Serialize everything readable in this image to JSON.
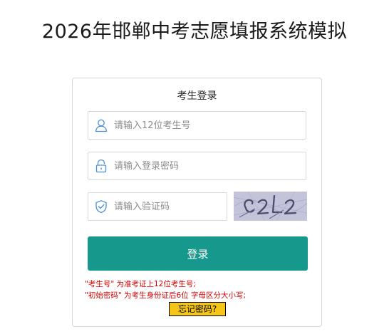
{
  "page": {
    "title": "2026年邯郸中考志愿填报系统模拟"
  },
  "login": {
    "title": "考生登录",
    "exam_id": {
      "placeholder": "请输入12位考生号",
      "value": "",
      "icon": "user-icon"
    },
    "password": {
      "placeholder": "请输入登录密码",
      "value": "",
      "icon": "lock-icon"
    },
    "captcha": {
      "placeholder": "请输入验证码",
      "value": "",
      "icon": "shield-check-icon",
      "image_text": "c2L2"
    },
    "submit_label": "登录",
    "hints": [
      "\"考生号\" 为准考证上12位考生号;",
      "\"初始密码\" 为考生身份证后6位 字母区分大小写;"
    ],
    "forgot_label": "忘记密码?"
  },
  "colors": {
    "primary": "#16998c",
    "icon": "#4a90d9",
    "hint": "#d40000",
    "forgot_bg": "#f5c518",
    "captcha_bg": "#bfc0d6"
  }
}
